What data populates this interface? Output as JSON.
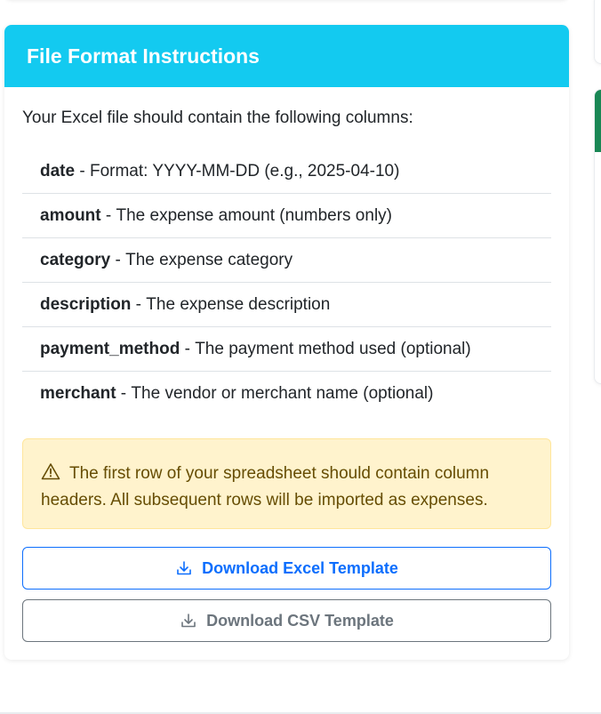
{
  "card": {
    "title": "File Format Instructions",
    "header_color": "#13caf0",
    "intro": "Your Excel file should contain the following columns:"
  },
  "columns": [
    {
      "name": "date",
      "desc": "Format: YYYY-MM-DD (e.g., 2025-04-10)"
    },
    {
      "name": "amount",
      "desc": "The expense amount (numbers only)"
    },
    {
      "name": "category",
      "desc": "The expense category"
    },
    {
      "name": "description",
      "desc": "The expense description"
    },
    {
      "name": "payment_method",
      "desc": "The payment method used (optional)"
    },
    {
      "name": "merchant",
      "desc": "The vendor or merchant name (optional)"
    }
  ],
  "alert": {
    "icon": "warning-triangle-icon",
    "text": "The first row of your spreadsheet should contain column headers. All subsequent rows will be imported as expenses."
  },
  "buttons": {
    "excel_label": "Download Excel Template",
    "csv_label": "Download CSV Template",
    "icon": "download-icon"
  }
}
